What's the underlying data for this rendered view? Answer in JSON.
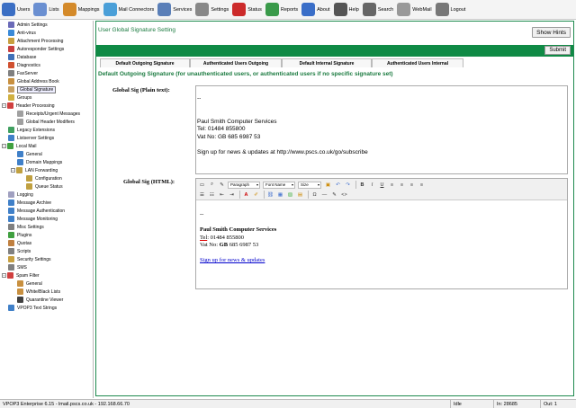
{
  "toolbar": {
    "items": [
      {
        "label": "Users",
        "icon": "users-icon",
        "color": "#3b6fc4"
      },
      {
        "label": "Lists",
        "icon": "lists-icon",
        "color": "#6a8fd1"
      },
      {
        "label": "Mappings",
        "icon": "mappings-icon",
        "color": "#d48a2a"
      },
      {
        "label": "Mail Connectors",
        "icon": "mail-connectors-icon",
        "color": "#4a9fd8"
      },
      {
        "label": "Services",
        "icon": "services-icon",
        "color": "#5a7fb8"
      },
      {
        "label": "Settings",
        "icon": "settings-icon",
        "color": "#888888"
      },
      {
        "label": "Status",
        "icon": "status-icon",
        "color": "#cc2a2a"
      },
      {
        "label": "Reports",
        "icon": "reports-icon",
        "color": "#3a9a4a"
      },
      {
        "label": "About",
        "icon": "about-icon",
        "color": "#3a6ec8"
      },
      {
        "label": "Help",
        "icon": "help-icon",
        "color": "#555555"
      },
      {
        "label": "Search",
        "icon": "search-icon",
        "color": "#666666"
      },
      {
        "label": "WebMail",
        "icon": "webmail-icon",
        "color": "#999999"
      },
      {
        "label": "Logout",
        "icon": "logout-icon",
        "color": "#777777"
      }
    ]
  },
  "tree": {
    "items": [
      {
        "label": "Admin Settings",
        "level": 0,
        "color": "#6a6ab8"
      },
      {
        "label": "Anti-virus",
        "level": 0,
        "color": "#3a8ad8"
      },
      {
        "label": "Attachment Processing",
        "level": 0,
        "color": "#c8a040"
      },
      {
        "label": "Autoresponder Settings",
        "level": 0,
        "color": "#c84040"
      },
      {
        "label": "Database",
        "level": 0,
        "color": "#4070b8"
      },
      {
        "label": "Diagnostics",
        "level": 0,
        "color": "#d05030"
      },
      {
        "label": "FaxServer",
        "level": 0,
        "color": "#808080"
      },
      {
        "label": "Global Address Book",
        "level": 0,
        "color": "#c89040"
      },
      {
        "label": "Global Signature",
        "level": 0,
        "color": "#c8a060",
        "selected": true
      },
      {
        "label": "Groups",
        "level": 0,
        "color": "#d0b040"
      },
      {
        "label": "Header Processing",
        "level": 0,
        "color": "#d04040",
        "expander": "−"
      },
      {
        "label": "Receipts/Urgent Messages",
        "level": 1,
        "color": "#a0a0a0"
      },
      {
        "label": "Global Header Modifiers",
        "level": 1,
        "color": "#a0a0a0"
      },
      {
        "label": "Legacy Extensions",
        "level": 0,
        "color": "#40a060"
      },
      {
        "label": "Listserver Settings",
        "level": 0,
        "color": "#4080c8"
      },
      {
        "label": "Local Mail",
        "level": 0,
        "color": "#40a040",
        "expander": "−"
      },
      {
        "label": "General",
        "level": 1,
        "color": "#4080c8"
      },
      {
        "label": "Domain Mappings",
        "level": 1,
        "color": "#4080c8"
      },
      {
        "label": "LAN Forwarding",
        "level": 1,
        "color": "#c0a040",
        "expander": "−"
      },
      {
        "label": "Configuration",
        "level": 2,
        "color": "#c0a040"
      },
      {
        "label": "Queue Status",
        "level": 2,
        "color": "#c0a040"
      },
      {
        "label": "Logging",
        "level": 0,
        "color": "#a0a0c0"
      },
      {
        "label": "Message Archive",
        "level": 0,
        "color": "#4080c8"
      },
      {
        "label": "Message Authentication",
        "level": 0,
        "color": "#4080c8"
      },
      {
        "label": "Message Monitoring",
        "level": 0,
        "color": "#4080c8"
      },
      {
        "label": "Misc Settings",
        "level": 0,
        "color": "#808080"
      },
      {
        "label": "Plugins",
        "level": 0,
        "color": "#40a040"
      },
      {
        "label": "Quotas",
        "level": 0,
        "color": "#c08040"
      },
      {
        "label": "Scripts",
        "level": 0,
        "color": "#808080"
      },
      {
        "label": "Security Settings",
        "level": 0,
        "color": "#c8a040"
      },
      {
        "label": "SMS",
        "level": 0,
        "color": "#808080"
      },
      {
        "label": "Spam Filter",
        "level": 0,
        "color": "#d04040",
        "expander": "−"
      },
      {
        "label": "General",
        "level": 1,
        "color": "#c89040"
      },
      {
        "label": "White/Black Lists",
        "level": 1,
        "color": "#c89040"
      },
      {
        "label": "Quarantine Viewer",
        "level": 1,
        "color": "#404040"
      },
      {
        "label": "VPOP3 Text Strings",
        "level": 0,
        "color": "#4080c8"
      }
    ]
  },
  "content": {
    "title": "User Global Signature Setting",
    "hints_label": "Show Hints",
    "submit_label": "Submit",
    "tabs": [
      {
        "label": "Default Outgoing Signature"
      },
      {
        "label": "Authenticated Users Outgoing"
      },
      {
        "label": "Default Internal Signature"
      },
      {
        "label": "Authenticated Users Internal"
      }
    ],
    "section_heading": "Default Outgoing Signature (for unauthenticated users, or authenticated users if no specific signature set)",
    "plain_label": "Global Sig (Plain text):",
    "plain_lines": [
      "--",
      "",
      "",
      "Paul Smith Computer Services",
      "Tel: 01484 855800",
      "Vat No: GB 685 6987 53",
      "",
      "Sign up for news & updates at http://www.pscs.co.uk/go/subscribe"
    ],
    "html_label": "Global Sig (HTML):",
    "editor": {
      "paragraph": "Paragraph",
      "font_name": "Font Name",
      "size": "Size",
      "body": {
        "dash": "--",
        "company": "Paul Smith Computer Services",
        "tel_prefix": "Tel",
        "tel_rest": ": 01484 855800",
        "vat_prefix": "Vat No: ",
        "vat_strong": "GB",
        "vat_rest": " 685 6987 53",
        "link": "Sign up for news & updates "
      }
    }
  },
  "statusbar": {
    "product": "VPOP3 Enterprise 6.15 - lmail.pscs.co.uk - 192.168.66.70",
    "state": "Idle",
    "in": "In: 28685",
    "out": "Out: 1"
  }
}
